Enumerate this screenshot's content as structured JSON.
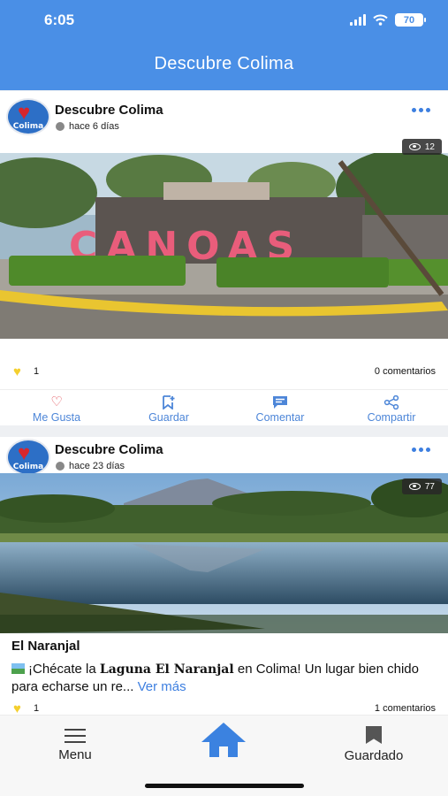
{
  "status_bar": {
    "time": "6:05",
    "battery": "70"
  },
  "app": {
    "title": "Descubre Colima"
  },
  "posts": [
    {
      "author": "Descubre Colima",
      "avatar_label": "Colima",
      "time_ago": "hace 6 días",
      "views": "12",
      "likes": "1",
      "comments": "0 comentarios",
      "sign_text": "CANOAS"
    },
    {
      "author": "Descubre Colima",
      "avatar_label": "Colima",
      "time_ago": "hace 23 días",
      "views": "77",
      "title": "El Naranjal",
      "body_prefix": "¡Chécate la ",
      "body_bold": "Laguna El Naranjal",
      "body_suffix": " en Colima! Un lugar bien chido para echarse un re...",
      "see_more": "Ver más",
      "likes": "1",
      "comments": "1 comentarios"
    }
  ],
  "actions": {
    "like": "Me Gusta",
    "save": "Guardar",
    "comment": "Comentar",
    "share": "Compartir"
  },
  "bottom_nav": {
    "menu": "Menu",
    "saved": "Guardado"
  },
  "colors": {
    "header": "#4a8fe6",
    "accent": "#3d7fe0",
    "like_yellow": "#f4cf2e",
    "like_red": "#e14b55"
  },
  "icons": [
    "wifi-icon",
    "signal-icon",
    "battery-icon",
    "more-icon",
    "eye-icon",
    "heart-icon",
    "bookmark-add-icon",
    "comment-icon",
    "share-icon",
    "menu-icon",
    "home-icon",
    "bookmark-icon",
    "clock-icon"
  ]
}
